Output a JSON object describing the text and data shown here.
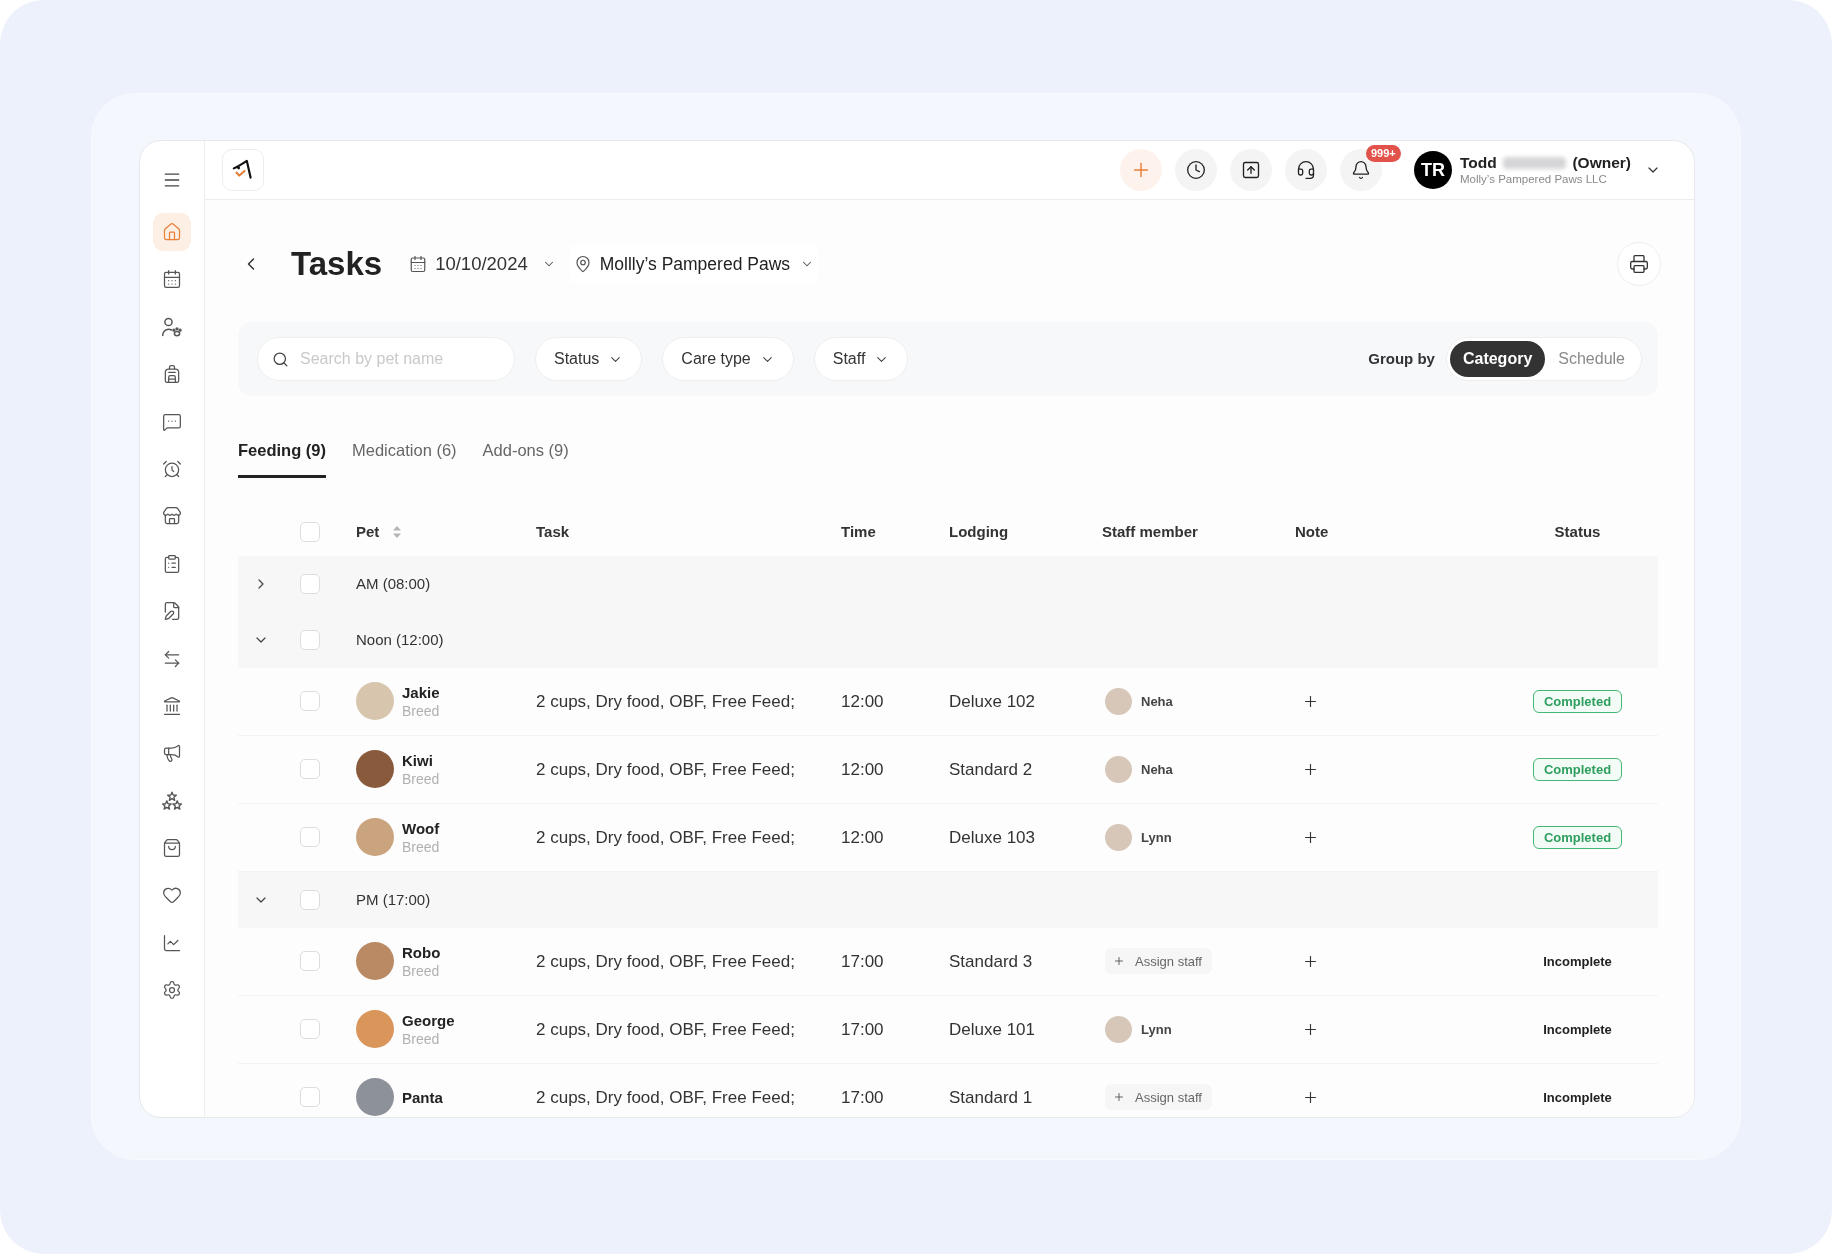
{
  "sidebar": {
    "items": [
      {
        "selected": true
      },
      {
        "selected": false
      },
      {
        "selected": false
      },
      {
        "selected": false
      },
      {
        "selected": false
      },
      {
        "selected": false
      },
      {
        "selected": false
      },
      {
        "selected": false
      },
      {
        "selected": false
      },
      {
        "selected": false
      },
      {
        "selected": false
      },
      {
        "selected": false
      },
      {
        "selected": false
      },
      {
        "selected": false
      },
      {
        "selected": false
      },
      {
        "selected": false
      },
      {
        "selected": false
      }
    ]
  },
  "top_bar": {
    "notification_badge": "999+",
    "user": {
      "initials": "TR",
      "name": "Todd",
      "role": "(Owner)",
      "company": "Molly’s Pampered Paws LLC"
    }
  },
  "header": {
    "title": "Tasks",
    "date": "10/10/2024",
    "location": "Mollly’s Pampered Paws"
  },
  "filters": {
    "search": {
      "placeholder": "Search by pet name"
    },
    "dropdowns": [
      "Status",
      "Care type",
      "Staff"
    ],
    "group_by": {
      "label": "Group by",
      "options": [
        {
          "label": "Category",
          "selected": true
        },
        {
          "label": "Schedule",
          "selected": false
        }
      ]
    }
  },
  "tabs": [
    {
      "label": "Feeding (9)",
      "selected": true
    },
    {
      "label": "Medication (6)",
      "selected": false
    },
    {
      "label": "Add-ons (9)",
      "selected": false
    }
  ],
  "table": {
    "header_checked": false,
    "columns": [
      {
        "label": "Pet",
        "sortable": true
      },
      {
        "label": "Task",
        "sortable": false
      },
      {
        "label": "Time",
        "sortable": false
      },
      {
        "label": "Lodging",
        "sortable": false
      },
      {
        "label": "Staff member",
        "sortable": false
      },
      {
        "label": "Note",
        "sortable": false
      },
      {
        "label": "Status",
        "sortable": false
      }
    ],
    "groups": [
      {
        "label": "AM (08:00)",
        "expanded": false,
        "checked": false
      },
      {
        "label": "Noon (12:00)",
        "expanded": true,
        "checked": false,
        "rows": [
          {
            "pet": "Jakie",
            "breed": "Breed",
            "checked": false,
            "task": "2 cups, Dry food, OBF, Free Feed;",
            "time": "12:00",
            "lodging": "Deluxe 102",
            "staff": {
              "kind": "assigned",
              "name": "Neha"
            },
            "status": {
              "kind": "completed",
              "label": "Completed"
            }
          },
          {
            "pet": "Kiwi",
            "breed": "Breed",
            "checked": false,
            "task": "2 cups, Dry food, OBF, Free Feed;",
            "time": "12:00",
            "lodging": "Standard 2",
            "staff": {
              "kind": "assigned",
              "name": "Neha"
            },
            "status": {
              "kind": "completed",
              "label": "Completed"
            }
          },
          {
            "pet": "Woof",
            "breed": "Breed",
            "checked": false,
            "task": "2 cups, Dry food, OBF, Free Feed;",
            "time": "12:00",
            "lodging": "Deluxe 103",
            "staff": {
              "kind": "assigned",
              "name": "Lynn"
            },
            "status": {
              "kind": "completed",
              "label": "Completed"
            }
          }
        ]
      },
      {
        "label": "PM (17:00)",
        "expanded": true,
        "checked": false,
        "rows": [
          {
            "pet": "Robo",
            "breed": "Breed",
            "checked": false,
            "task": "2 cups, Dry food, OBF, Free Feed;",
            "time": "17:00",
            "lodging": "Standard 3",
            "staff": {
              "kind": "unassigned",
              "label": "Assign staff"
            },
            "status": {
              "kind": "incomplete",
              "label": "Incomplete"
            }
          },
          {
            "pet": "George",
            "breed": "Breed",
            "checked": false,
            "task": "2 cups, Dry food, OBF, Free Feed;",
            "time": "17:00",
            "lodging": "Deluxe 101",
            "staff": {
              "kind": "assigned",
              "name": "Lynn"
            },
            "status": {
              "kind": "incomplete",
              "label": "Incomplete"
            }
          },
          {
            "pet": "Panta",
            "checked": false,
            "task": "2 cups, Dry food, OBF, Free Feed;",
            "time": "17:00",
            "lodging": "Standard 1",
            "staff": {
              "kind": "unassigned",
              "label": "Assign staff"
            },
            "status": {
              "kind": "incomplete",
              "label": "Incomplete"
            }
          }
        ]
      }
    ]
  }
}
